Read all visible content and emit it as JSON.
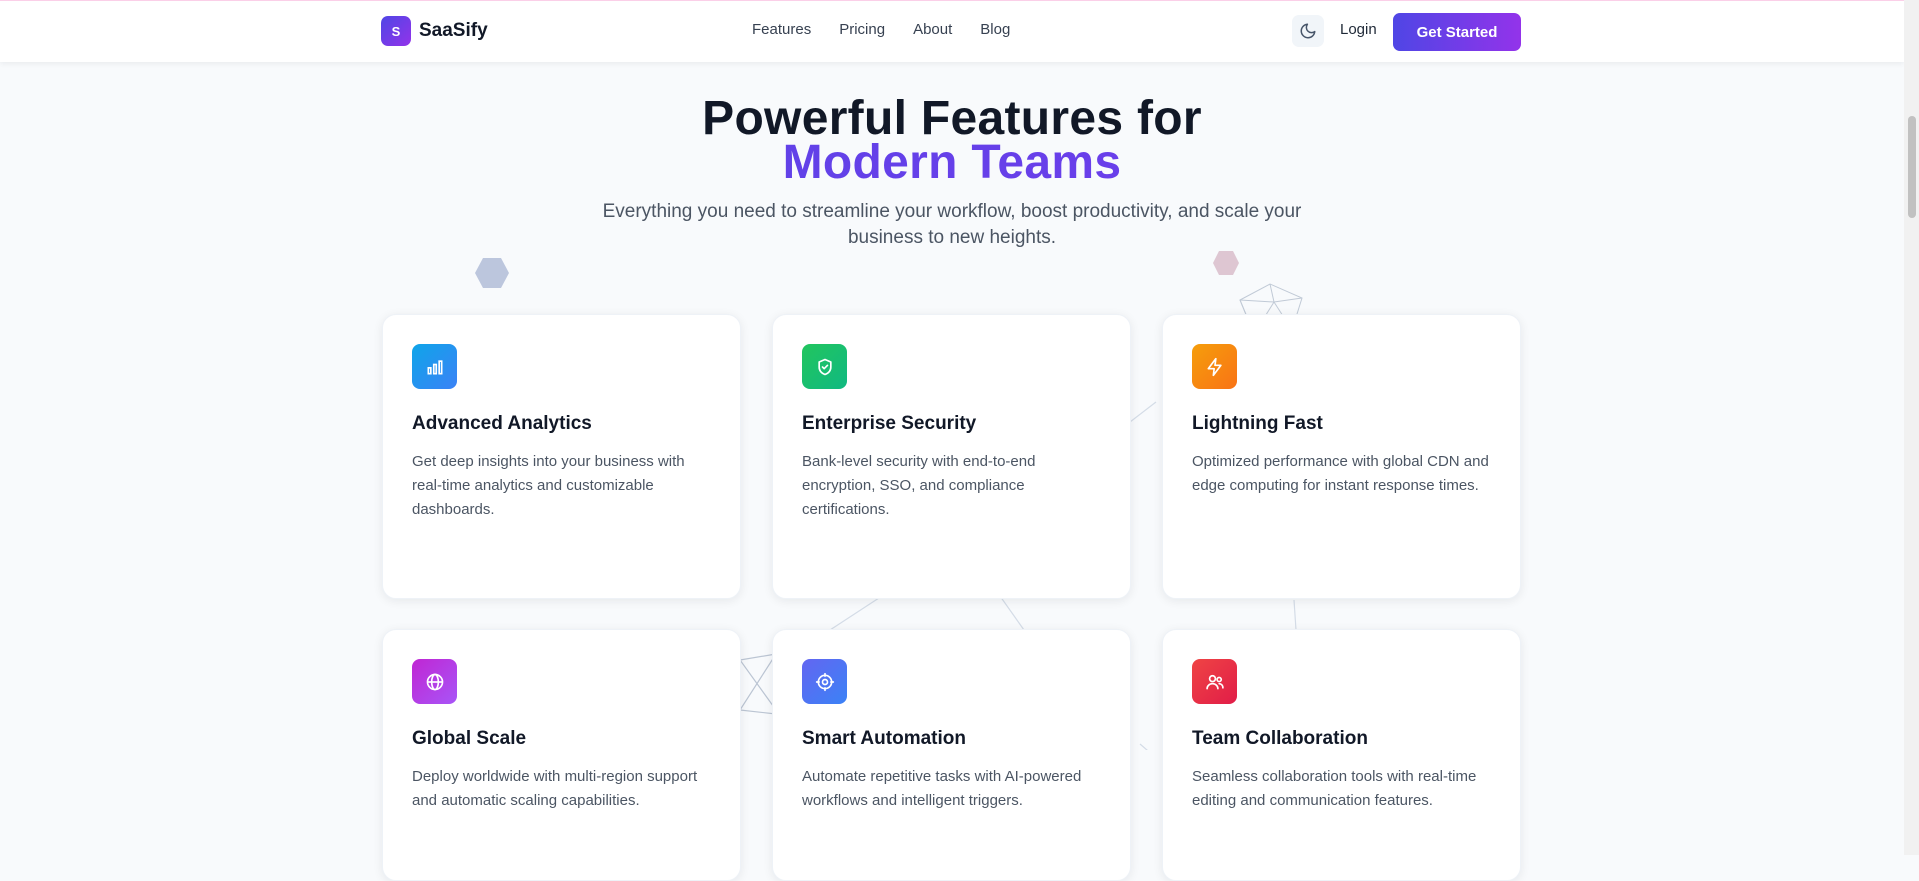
{
  "nav": {
    "brand_initial": "S",
    "brand_name": "SaaSify",
    "links": [
      "Features",
      "Pricing",
      "About",
      "Blog"
    ],
    "theme_icon": "moon-icon",
    "login_label": "Login",
    "cta_label": "Get Started"
  },
  "hero": {
    "title_line1": "Powerful Features for",
    "title_line2": "Modern Teams",
    "subtitle": "Everything you need to streamline your workflow, boost productivity, and scale your business to new heights."
  },
  "features": [
    {
      "title": "Advanced Analytics",
      "description": "Get deep insights into your business with real-time analytics and customizable dashboards.",
      "icon": "bar-chart-icon",
      "gradient": [
        "#0ea5e9",
        "#3b82f6"
      ]
    },
    {
      "title": "Enterprise Security",
      "description": "Bank-level security with end-to-end encryption, SSO, and compliance certifications.",
      "icon": "shield-check-icon",
      "gradient": [
        "#22c55e",
        "#10b981"
      ]
    },
    {
      "title": "Lightning Fast",
      "description": "Optimized performance with global CDN and edge computing for instant response times.",
      "icon": "lightning-icon",
      "gradient": [
        "#f59e0b",
        "#f97316"
      ]
    },
    {
      "title": "Global Scale",
      "description": "Deploy worldwide with multi-region support and automatic scaling capabilities.",
      "icon": "globe-icon",
      "gradient": [
        "#c026d3",
        "#a855f7"
      ]
    },
    {
      "title": "Smart Automation",
      "description": "Automate repetitive tasks with AI-powered workflows and intelligent triggers.",
      "icon": "gear-icon",
      "gradient": [
        "#6366f1",
        "#3b82f6"
      ]
    },
    {
      "title": "Team Collaboration",
      "description": "Seamless collaboration tools with real-time editing and communication features.",
      "icon": "users-icon",
      "gradient": [
        "#ef4444",
        "#e11d48"
      ]
    }
  ],
  "colors": {
    "accent": "#4f46e5",
    "accent_end": "#9333ea"
  }
}
